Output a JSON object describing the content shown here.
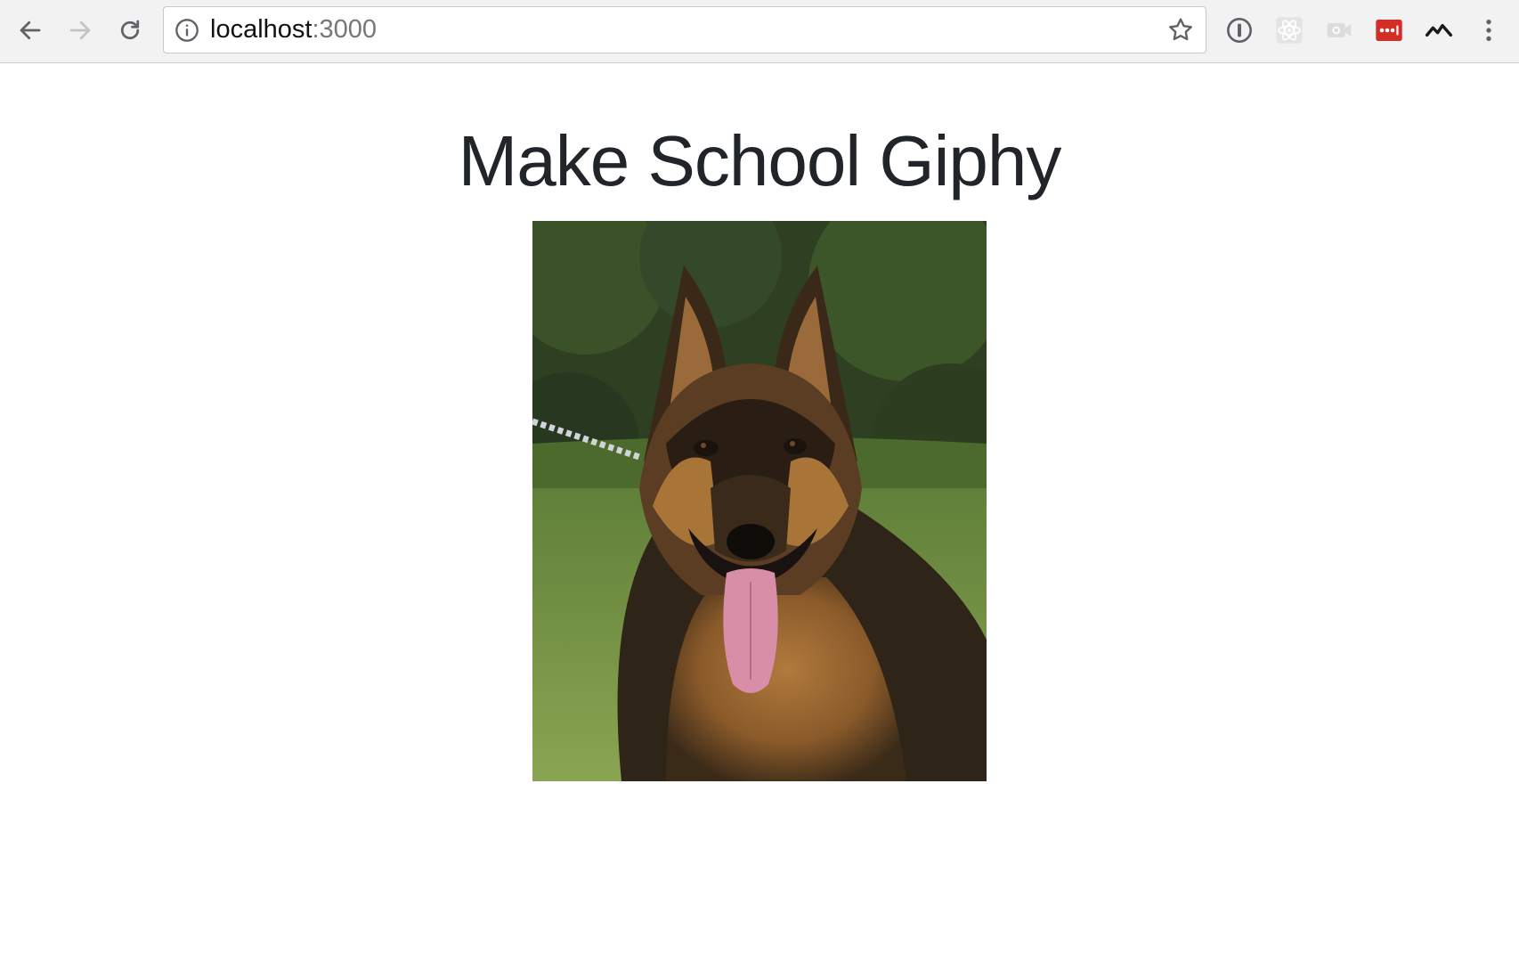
{
  "browser": {
    "url_host": "localhost",
    "url_port": ":3000",
    "extensions": [
      "onepassword-icon",
      "react-devtools-icon",
      "screencast-icon",
      "lastpass-icon",
      "codestream-icon"
    ],
    "colors": {
      "lastpass": "#d32d27",
      "toolbar": "#f2f2f2"
    }
  },
  "page": {
    "title": "Make School Giphy",
    "gif_subject": "dog-photo"
  }
}
